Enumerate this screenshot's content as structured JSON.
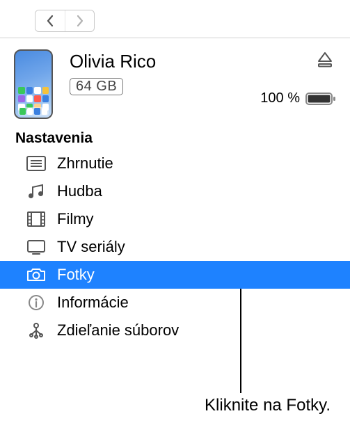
{
  "device": {
    "name": "Olivia Rico",
    "storage": "64 GB",
    "battery_percent": "100 %"
  },
  "sidebar": {
    "section_header": "Nastavenia",
    "items": [
      {
        "label": "Zhrnutie",
        "selected": false,
        "icon": "summary"
      },
      {
        "label": "Hudba",
        "selected": false,
        "icon": "music"
      },
      {
        "label": "Filmy",
        "selected": false,
        "icon": "film"
      },
      {
        "label": "TV seriály",
        "selected": false,
        "icon": "tv"
      },
      {
        "label": "Fotky",
        "selected": true,
        "icon": "camera"
      },
      {
        "label": "Informácie",
        "selected": false,
        "icon": "info"
      },
      {
        "label": "Zdieľanie súborov",
        "selected": false,
        "icon": "apps"
      }
    ]
  },
  "caption": "Kliknite na Fotky."
}
